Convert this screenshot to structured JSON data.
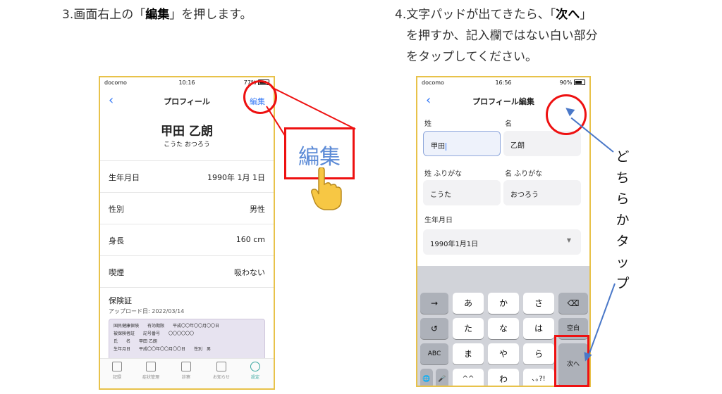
{
  "step3": {
    "prefix": "3.画面右上の「",
    "bold": "編集",
    "suffix": "」を押します。"
  },
  "step4": {
    "prefix": "4.文字パッドが出てきたら、「",
    "bold": "次へ",
    "suffix": "」",
    "line2": "を押すか、記入欄ではない白い部分",
    "line3": "をタップしてください。"
  },
  "callout": {
    "zoom_label": "編集",
    "vertical_text": [
      "ど",
      "ち",
      "ら",
      "か",
      "タ",
      "ッ",
      "プ"
    ]
  },
  "phone1": {
    "status": {
      "carrier": "docomo",
      "time": "10:16",
      "battery": "77%"
    },
    "nav": {
      "title": "プロフィール",
      "edit": "編集"
    },
    "name": "甲田 乙朗",
    "kana": "こうた おつろう",
    "rows": [
      {
        "label": "生年月日",
        "value": "1990年 1月 1日"
      },
      {
        "label": "性別",
        "value": "男性"
      },
      {
        "label": "身長",
        "value": "160 cm"
      },
      {
        "label": "喫煙",
        "value": "吸わない"
      }
    ],
    "insurance": {
      "title": "保険証",
      "upload": "アップロード日: 2022/03/14",
      "card_lines": [
        "国民健康保険　　有効期限　　平成〇〇年〇〇月〇〇日",
        "被保険者証　　記号番号　　〇〇〇〇〇〇",
        "氏　　名　　甲田 乙朗",
        "生年月日　　平成〇〇年〇〇月〇〇日　　性別　男"
      ]
    },
    "tabs": [
      "記録",
      "症状管理",
      "診察",
      "お知らせ",
      "設定"
    ]
  },
  "phone2": {
    "status": {
      "carrier": "docomo",
      "time": "16:56",
      "battery": "90%"
    },
    "nav": {
      "title": "プロフィール編集"
    },
    "labels": {
      "sei": "姓",
      "mei": "名",
      "sei_kana": "姓 ふりがな",
      "mei_kana": "名 ふりがな",
      "birthday": "生年月日"
    },
    "values": {
      "sei": "甲田",
      "mei": "乙朗",
      "sei_kana": "こうた",
      "mei_kana": "おつろう",
      "birthday": "1990年1月1日"
    },
    "keyboard": {
      "row1": [
        "→",
        "あ",
        "か",
        "さ",
        "⌫"
      ],
      "row2": [
        "↺",
        "た",
        "な",
        "は",
        "空白"
      ],
      "row3": [
        "ABC",
        "ま",
        "や",
        "ら"
      ],
      "row4": [
        "🌐",
        "🎤",
        "^^",
        "わ",
        "､｡?!"
      ],
      "next": "次へ"
    }
  }
}
